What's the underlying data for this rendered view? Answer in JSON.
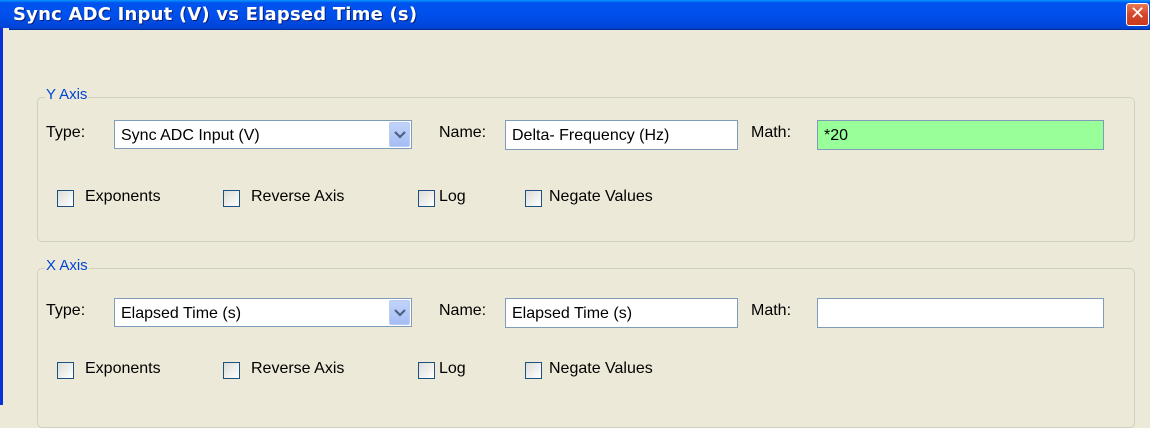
{
  "window": {
    "title": "Sync ADC Input (V) vs Elapsed Time (s)",
    "close_glyph": "✕"
  },
  "y_axis": {
    "legend": "Y Axis",
    "type_label": "Type:",
    "type_value": "Sync ADC Input (V)",
    "name_label": "Name:",
    "name_value": "Delta- Frequency (Hz)",
    "math_label": "Math:",
    "math_value": "*20",
    "math_bg_color": "#99ff99",
    "options": {
      "exponents": {
        "label": "Exponents",
        "checked": false
      },
      "reverse_axis": {
        "label": "Reverse Axis",
        "checked": false
      },
      "log": {
        "label": "Log",
        "checked": false
      },
      "negate_values": {
        "label": "Negate Values",
        "checked": false
      }
    }
  },
  "x_axis": {
    "legend": "X Axis",
    "type_label": "Type:",
    "type_value": "Elapsed Time (s)",
    "name_label": "Name:",
    "name_value": "Elapsed Time (s)",
    "math_label": "Math:",
    "math_value": "",
    "options": {
      "exponents": {
        "label": "Exponents",
        "checked": false
      },
      "reverse_axis": {
        "label": "Reverse Axis",
        "checked": false
      },
      "log": {
        "label": "Log",
        "checked": false
      },
      "negate_values": {
        "label": "Negate Values",
        "checked": false
      }
    }
  },
  "colors": {
    "titlebar": "#0050ee",
    "group_legend": "#0046d5",
    "dialog_bg": "#ece9d8"
  },
  "icons": {
    "close": "close-icon",
    "dropdown": "chevron-down-icon"
  }
}
